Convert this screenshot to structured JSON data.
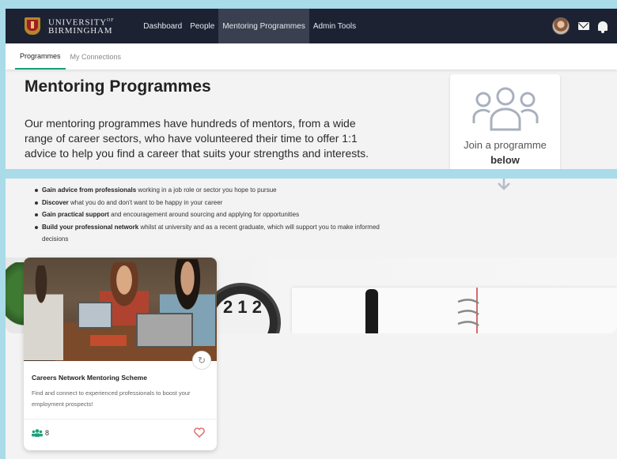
{
  "header": {
    "logo_line1": "UNIVERSITY",
    "logo_of": "OF",
    "logo_line2": "BIRMINGHAM",
    "nav": [
      {
        "label": "Dashboard"
      },
      {
        "label": "People"
      },
      {
        "label": "Mentoring Programmes"
      },
      {
        "label": "Admin Tools"
      }
    ],
    "active_nav": "Mentoring Programmes"
  },
  "subnav": {
    "tabs": [
      {
        "label": "Programmes"
      },
      {
        "label": "My Connections"
      }
    ]
  },
  "main": {
    "title": "Mentoring Programmes",
    "intro_line1": "Our mentoring programmes have hundreds of mentors, from a wide",
    "intro_line2": "range of career sectors, who have volunteered their time to offer 1:1",
    "intro_line3": "advice to help you find a career that suits your strengths and interests.",
    "join_line1": "Join a programme",
    "join_line2": "below",
    "bullets": [
      {
        "bold": "Gain advice from professionals",
        "rest": " working in a job role or sector you hope to pursue"
      },
      {
        "bold": "Discover",
        "rest": " what you do and don't want to be happy in your career"
      },
      {
        "bold": "Gain practical support",
        "rest": " and encouragement around sourcing and applying for opportunities"
      },
      {
        "bold": "Build your professional network",
        "rest": " whilst at university and as a recent graduate, which will support you to make informed decisions"
      }
    ],
    "banner_clock_text": "2 1 2"
  },
  "program_card": {
    "title": "Careers Network Mentoring Scheme",
    "description": "Find and connect to experienced professionals to boost your employment prospects!",
    "member_count": "8"
  },
  "colors": {
    "navbar": "#1d2233",
    "active_tab_underline": "#1aa07a",
    "heart": "#e06666",
    "people_icon": "#1aa07a",
    "background_frame": "#a9dbe9"
  },
  "icons": [
    "university-crest-icon",
    "avatar",
    "mail-icon",
    "bell-icon",
    "group-icon",
    "arrow-down-icon",
    "share-icon",
    "people-icon",
    "heart-icon"
  ]
}
